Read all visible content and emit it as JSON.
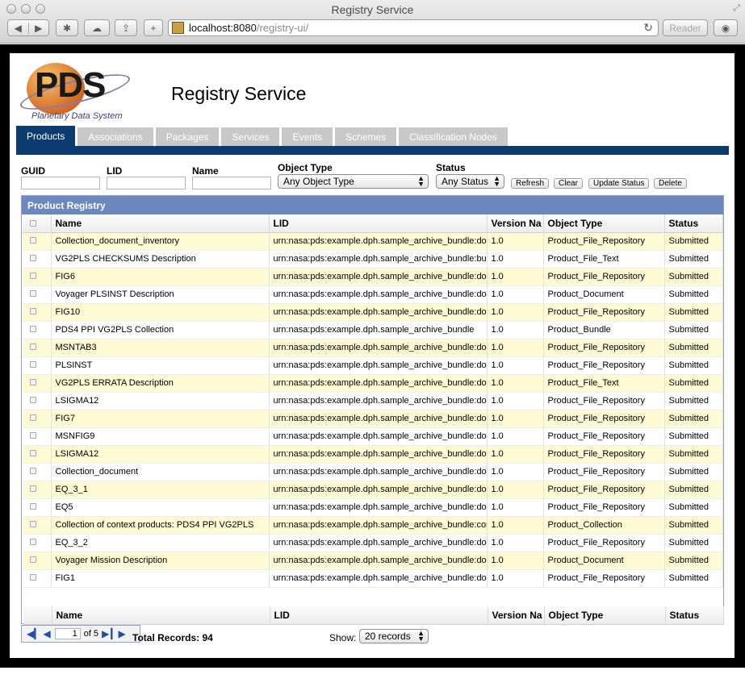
{
  "window": {
    "title": "Registry Service"
  },
  "browser": {
    "url_host": "localhost:8080",
    "url_path": "/registry-ui/",
    "reader_label": "Reader"
  },
  "header": {
    "logo_text": "PDS",
    "logo_subtitle": "Planetary Data System",
    "title": "Registry Service"
  },
  "tabs": [
    "Products",
    "Associations",
    "Packages",
    "Services",
    "Events",
    "Schemes",
    "Classification Nodes"
  ],
  "filters": {
    "guid_label": "GUID",
    "lid_label": "LID",
    "name_label": "Name",
    "object_type_label": "Object Type",
    "object_type_value": "Any Object Type",
    "status_label": "Status",
    "status_value": "Any Status",
    "buttons": {
      "refresh": "Refresh",
      "clear": "Clear",
      "update_status": "Update Status",
      "delete": "Delete"
    }
  },
  "grid": {
    "title": "Product Registry",
    "columns": [
      "Name",
      "LID",
      "Version Na",
      "Object Type",
      "Status"
    ],
    "rows": [
      [
        "Collection_document_inventory",
        "urn:nasa:pds:example.dph.sample_archive_bundle:doc",
        "1.0",
        "Product_File_Repository",
        "Submitted"
      ],
      [
        "VG2PLS CHECKSUMS Description",
        "urn:nasa:pds:example.dph.sample_archive_bundle:bun",
        "1.0",
        "Product_File_Text",
        "Submitted"
      ],
      [
        "FIG6",
        "urn:nasa:pds:example.dph.sample_archive_bundle:doc",
        "1.0",
        "Product_File_Repository",
        "Submitted"
      ],
      [
        "Voyager PLSINST Description",
        "urn:nasa:pds:example.dph.sample_archive_bundle:doc",
        "1.0",
        "Product_Document",
        "Submitted"
      ],
      [
        "FIG10",
        "urn:nasa:pds:example.dph.sample_archive_bundle:doc",
        "1.0",
        "Product_File_Repository",
        "Submitted"
      ],
      [
        "PDS4 PPI VG2PLS Collection",
        "urn:nasa:pds:example.dph.sample_archive_bundle",
        "1.0",
        "Product_Bundle",
        "Submitted"
      ],
      [
        "MSNTAB3",
        "urn:nasa:pds:example.dph.sample_archive_bundle:doc",
        "1.0",
        "Product_File_Repository",
        "Submitted"
      ],
      [
        "PLSINST",
        "urn:nasa:pds:example.dph.sample_archive_bundle:doc",
        "1.0",
        "Product_File_Repository",
        "Submitted"
      ],
      [
        "VG2PLS ERRATA Description",
        "urn:nasa:pds:example.dph.sample_archive_bundle:doc",
        "1.0",
        "Product_File_Text",
        "Submitted"
      ],
      [
        "LSIGMA12",
        "urn:nasa:pds:example.dph.sample_archive_bundle:doc",
        "1.0",
        "Product_File_Repository",
        "Submitted"
      ],
      [
        "FIG7",
        "urn:nasa:pds:example.dph.sample_archive_bundle:doc",
        "1.0",
        "Product_File_Repository",
        "Submitted"
      ],
      [
        "MSNFIG9",
        "urn:nasa:pds:example.dph.sample_archive_bundle:doc",
        "1.0",
        "Product_File_Repository",
        "Submitted"
      ],
      [
        "LSIGMA12",
        "urn:nasa:pds:example.dph.sample_archive_bundle:doc",
        "1.0",
        "Product_File_Repository",
        "Submitted"
      ],
      [
        "Collection_document",
        "urn:nasa:pds:example.dph.sample_archive_bundle:doc",
        "1.0",
        "Product_File_Repository",
        "Submitted"
      ],
      [
        "EQ_3_1",
        "urn:nasa:pds:example.dph.sample_archive_bundle:doc",
        "1.0",
        "Product_File_Repository",
        "Submitted"
      ],
      [
        "EQ5",
        "urn:nasa:pds:example.dph.sample_archive_bundle:doc",
        "1.0",
        "Product_File_Repository",
        "Submitted"
      ],
      [
        "Collection of context products: PDS4 PPI VG2PLS",
        "urn:nasa:pds:example.dph.sample_archive_bundle:con",
        "1.0",
        "Product_Collection",
        "Submitted"
      ],
      [
        "EQ_3_2",
        "urn:nasa:pds:example.dph.sample_archive_bundle:doc",
        "1.0",
        "Product_File_Repository",
        "Submitted"
      ],
      [
        "Voyager Mission Description",
        "urn:nasa:pds:example.dph.sample_archive_bundle:doc",
        "1.0",
        "Product_Document",
        "Submitted"
      ],
      [
        "FIG1",
        "urn:nasa:pds:example.dph.sample_archive_bundle:doc",
        "1.0",
        "Product_File_Repository",
        "Submitted"
      ]
    ]
  },
  "pager": {
    "page": "1",
    "of_label": "of 5",
    "total_label": "Total Records: 94",
    "show_label": "Show:",
    "show_value": "20 records"
  }
}
